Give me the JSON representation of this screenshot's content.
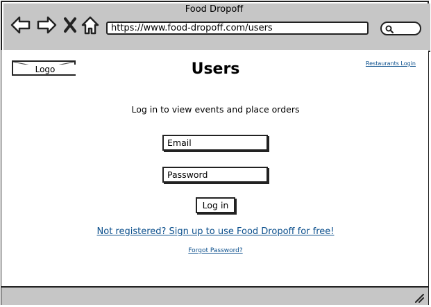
{
  "window": {
    "title": "Food Dropoff"
  },
  "address_bar": {
    "url": "https://www.food-dropoff.com/users"
  },
  "header": {
    "logo_label": "Logo",
    "page_title": "Users",
    "restaurants_login": "Restaurants Login"
  },
  "login": {
    "subtitle": "Log in to view events and place orders",
    "email_value": "Email",
    "password_value": "Password",
    "login_button": "Log in",
    "signup_link": "Not registered? Sign up to use Food Dropoff for free!",
    "forgot_link": "Forgot Password?"
  },
  "colors": {
    "link": "#0b4f8c",
    "chrome": "#c6c6c6"
  },
  "icons": [
    "back-arrow-icon",
    "forward-arrow-icon",
    "close-icon",
    "home-icon",
    "search-icon",
    "resize-grip-icon"
  ]
}
